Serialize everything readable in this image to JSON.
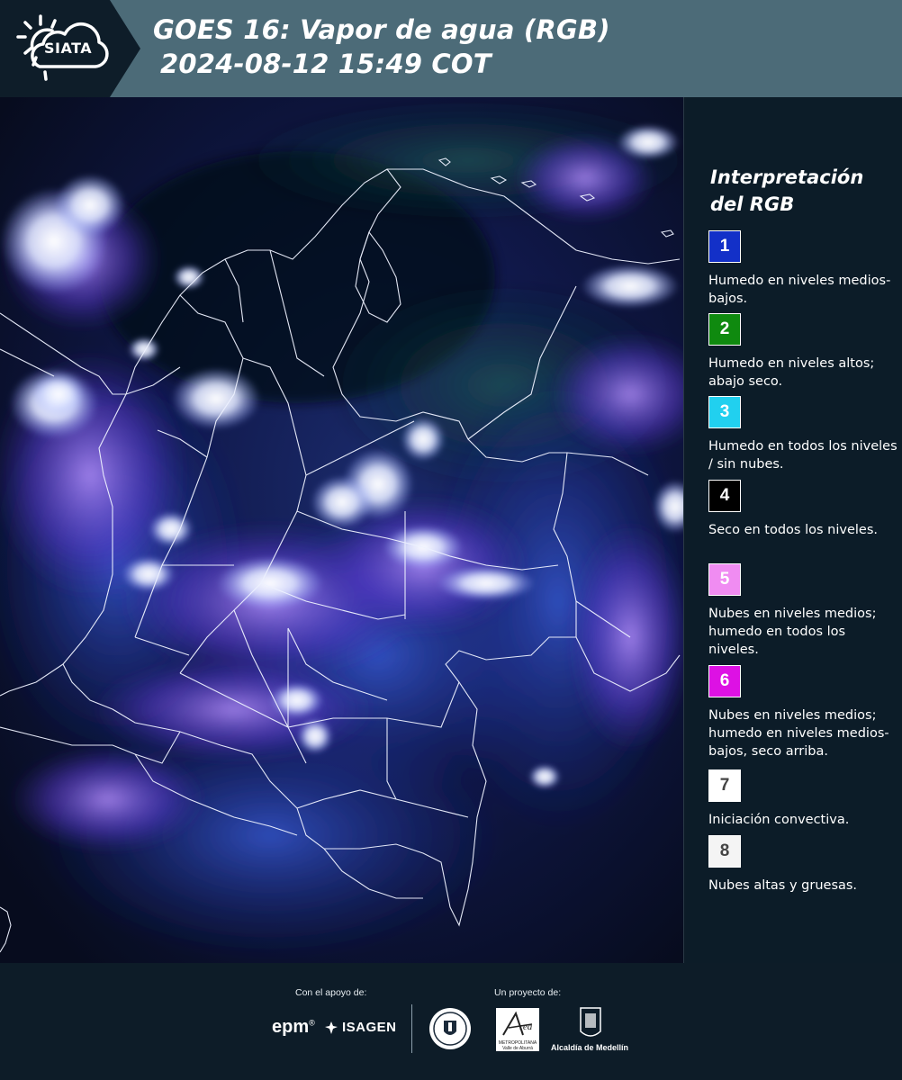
{
  "header": {
    "logo_text": "SIATA",
    "title_line1": "GOES 16: Vapor de agua (RGB)",
    "title_line2": "2024-08-12 15:49 COT"
  },
  "legend": {
    "title": "Interpretación del RGB",
    "items": [
      {
        "number": "1",
        "color": "#1330c8",
        "number_color": "#ffffff",
        "text": "Humedo en niveles medios-bajos."
      },
      {
        "number": "2",
        "color": "#0f8a0f",
        "number_color": "#ffffff",
        "text": "Humedo en niveles altos; abajo seco."
      },
      {
        "number": "3",
        "color": "#21d0ef",
        "number_color": "#ffffff",
        "text": "Humedo en todos los niveles / sin nubes."
      },
      {
        "number": "4",
        "color": "#000000",
        "number_color": "#ffffff",
        "text": "Seco en todos los niveles."
      },
      {
        "number": "5",
        "color": "#f08cf2",
        "number_color": "#ffffff",
        "text": "Nubes en niveles medios; humedo en todos los niveles."
      },
      {
        "number": "6",
        "color": "#dd11e4",
        "number_color": "#ffffff",
        "text": "Nubes en niveles medios; humedo en niveles medios-bajos, seco arriba."
      },
      {
        "number": "7",
        "color": "#ffffff",
        "number_color": "#444444",
        "text": "Iniciación convectiva."
      },
      {
        "number": "8",
        "color": "#f4f4f4",
        "number_color": "#444444",
        "text": "Nubes altas y gruesas."
      }
    ]
  },
  "footer": {
    "support_label": "Con el apoyo de:",
    "project_label": "Un proyecto de:",
    "epm": "epm",
    "isagen": "ISAGEN",
    "area_label": "METROPOLITANA Valle de Aburrá",
    "alcaldia": "Alcaldía de Medellín"
  }
}
